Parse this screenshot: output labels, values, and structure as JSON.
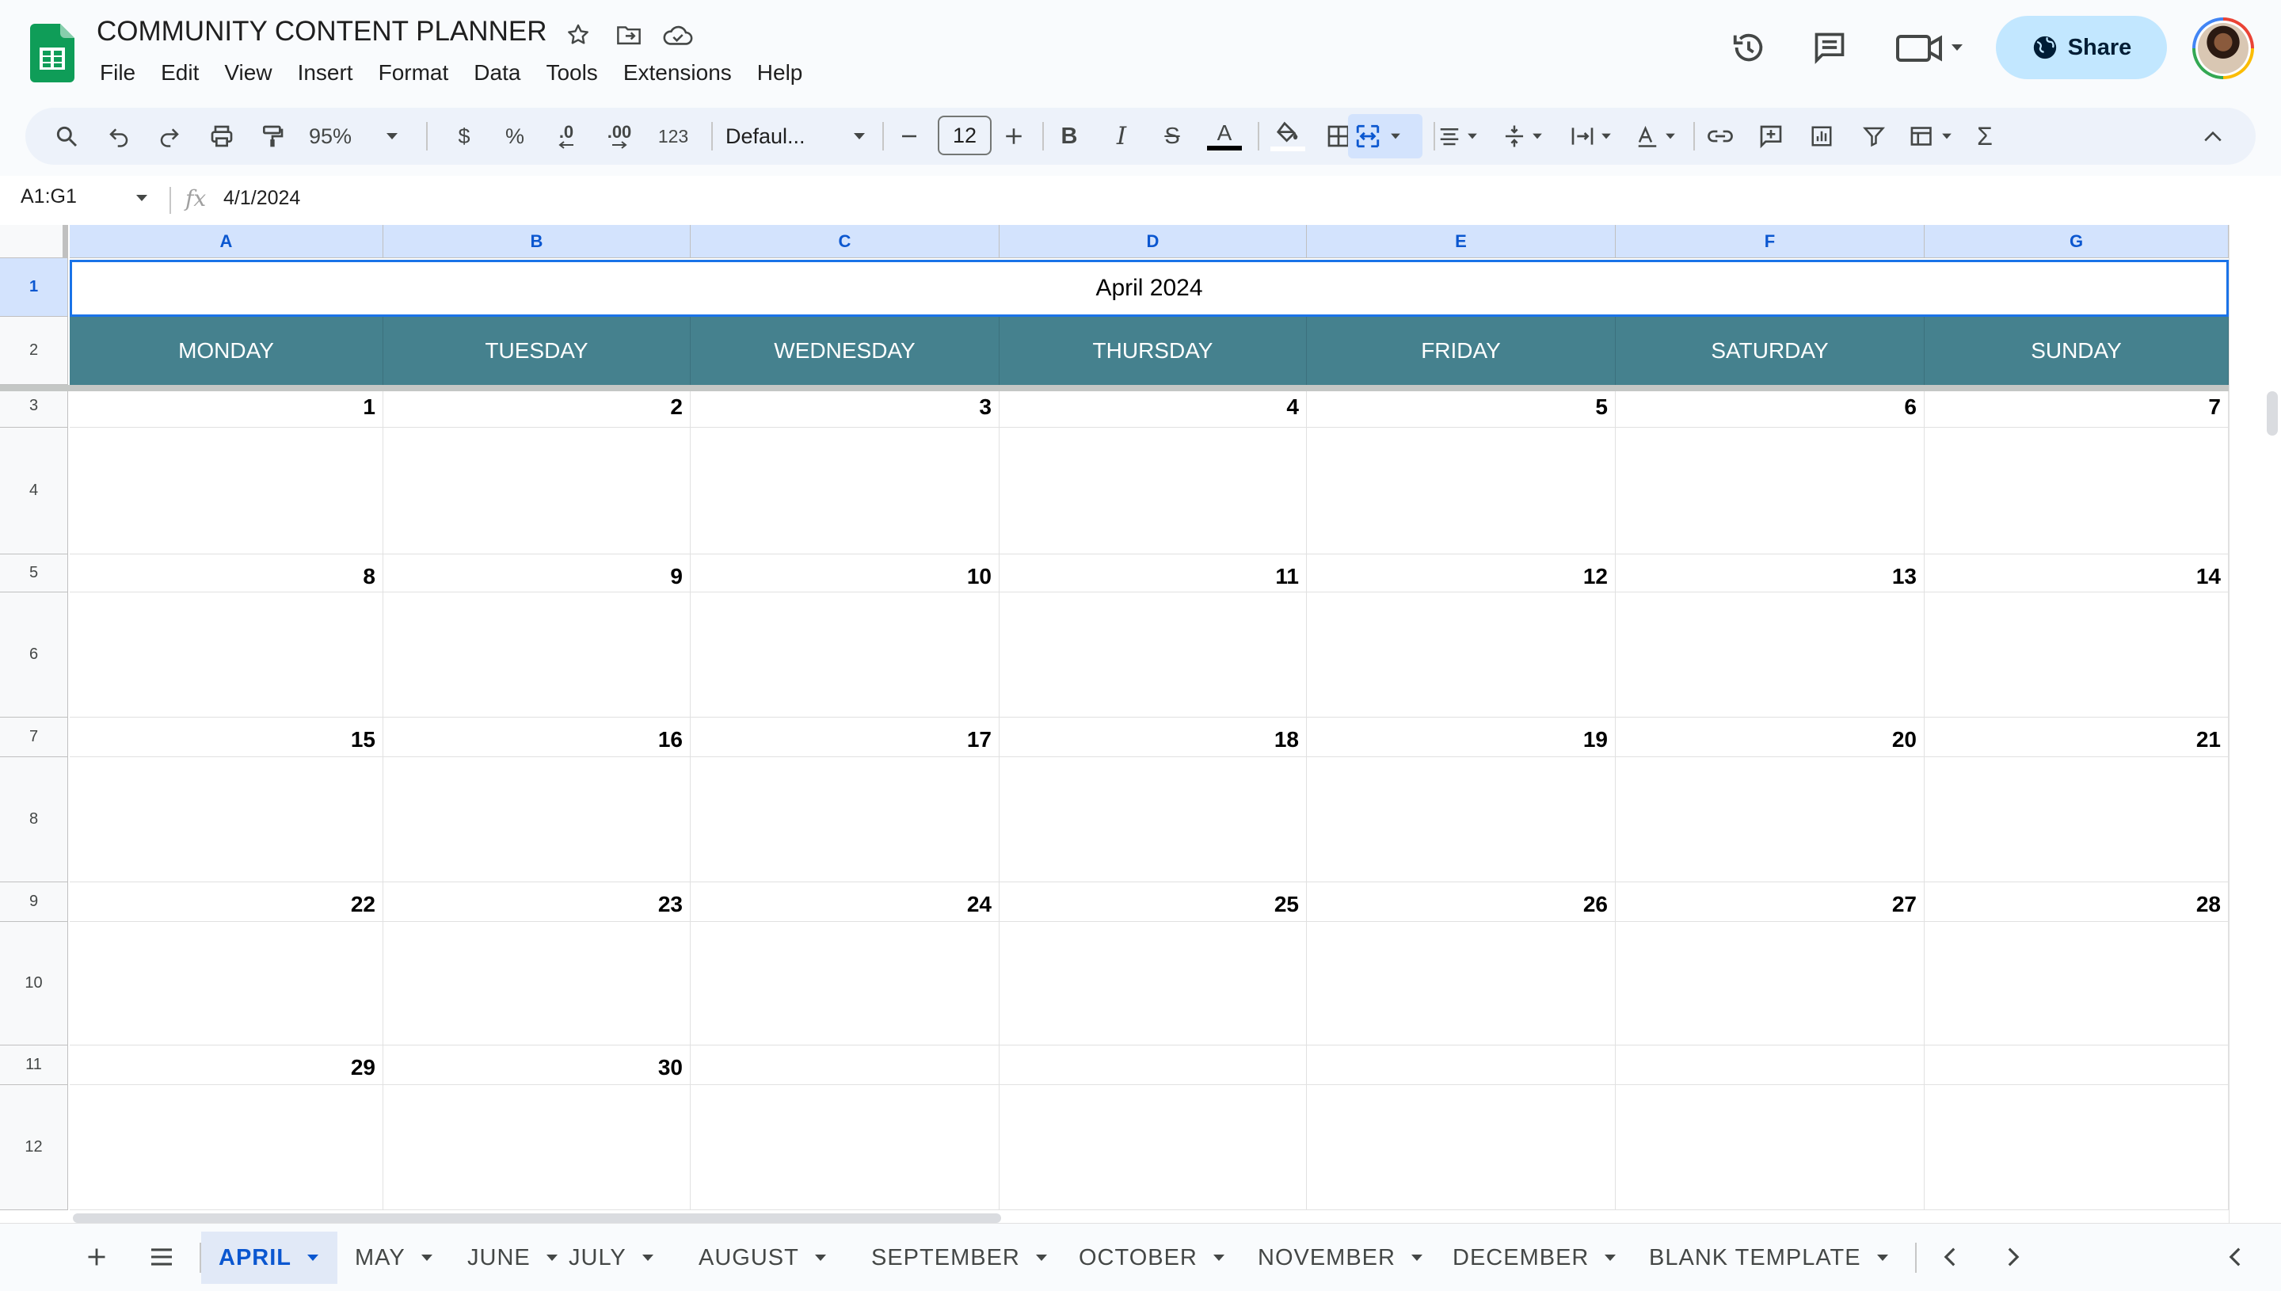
{
  "app": {
    "doc_title": "COMMUNITY CONTENT PLANNER",
    "menu": [
      "File",
      "Edit",
      "View",
      "Insert",
      "Format",
      "Data",
      "Tools",
      "Extensions",
      "Help"
    ],
    "share_label": "Share"
  },
  "toolbar": {
    "zoom": "95%",
    "currency": "$",
    "percent": "%",
    "decimal_decrease": ".0",
    "decimal_increase": ".00",
    "number_format": "123",
    "font": "Defaul...",
    "font_size": "12"
  },
  "formula_bar": {
    "name_box": "A1:G1",
    "fx": "fx",
    "value": "4/1/2024"
  },
  "grid": {
    "columns": [
      "A",
      "B",
      "C",
      "D",
      "E",
      "F",
      "G"
    ],
    "rows": [
      "1",
      "2",
      "3",
      "4",
      "5",
      "6",
      "7",
      "8",
      "9",
      "10",
      "11",
      "12"
    ],
    "month_title": "April 2024",
    "weekdays": [
      "MONDAY",
      "TUESDAY",
      "WEDNESDAY",
      "THURSDAY",
      "FRIDAY",
      "SATURDAY",
      "SUNDAY"
    ],
    "weeks": [
      [
        "1",
        "2",
        "3",
        "4",
        "5",
        "6",
        "7"
      ],
      [
        "8",
        "9",
        "10",
        "11",
        "12",
        "13",
        "14"
      ],
      [
        "15",
        "16",
        "17",
        "18",
        "19",
        "20",
        "21"
      ],
      [
        "22",
        "23",
        "24",
        "25",
        "26",
        "27",
        "28"
      ],
      [
        "29",
        "30",
        "",
        "",
        "",
        "",
        ""
      ]
    ],
    "header_color": "#45818e"
  },
  "sheets": {
    "tabs": [
      "APRIL",
      "MAY",
      "JUNE",
      "JULY",
      "AUGUST",
      "SEPTEMBER",
      "OCTOBER",
      "NOVEMBER",
      "DECEMBER",
      "BLANK TEMPLATE"
    ],
    "active": "APRIL"
  }
}
